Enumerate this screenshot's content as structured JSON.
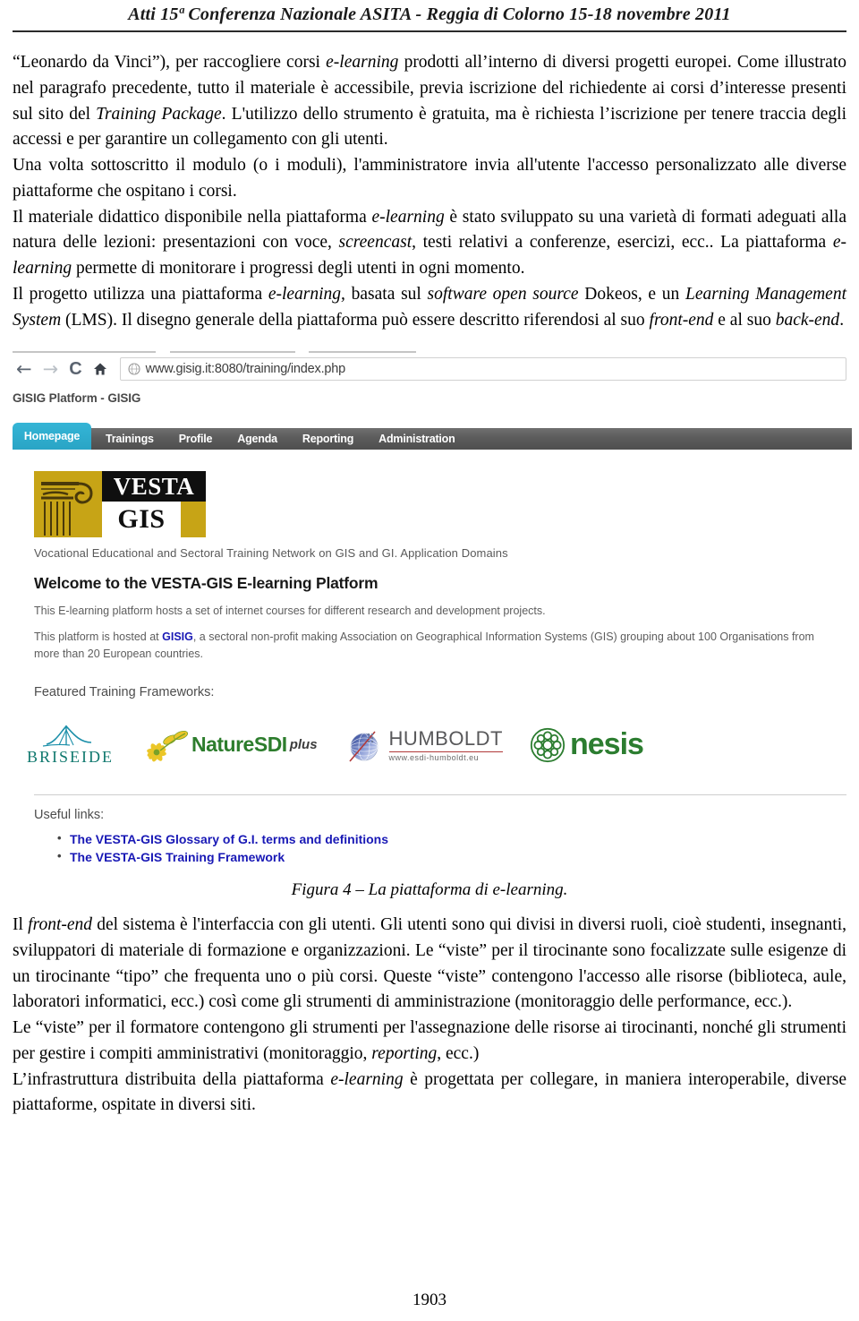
{
  "header": {
    "running_title": "Atti 15ª Conferenza Nazionale ASITA - Reggia di Colorno 15-18 novembre 2011"
  },
  "document": {
    "paragraphs": [
      {
        "id": "p1",
        "runs": [
          {
            "t": "“Leonardo da Vinci”), per raccogliere corsi ",
            "i": false
          },
          {
            "t": "e-learning",
            "i": true
          },
          {
            "t": " prodotti all’interno di diversi progetti europei. Come illustrato nel paragrafo precedente, tutto il materiale è accessibile, previa iscrizione del richiedente ai corsi d’interesse presenti sul sito del ",
            "i": false
          },
          {
            "t": "Training Package",
            "i": true
          },
          {
            "t": ". L'utilizzo dello strumento è gratuita, ma è richiesta l’iscrizione per tenere traccia degli accessi e per garantire un collegamento con gli utenti.",
            "i": false
          }
        ]
      },
      {
        "id": "p2",
        "runs": [
          {
            "t": "Una volta sottoscritto il modulo (o i moduli), l'amministratore invia all'utente l'accesso personalizzato alle diverse piattaforme che ospitano i corsi.",
            "i": false
          }
        ]
      },
      {
        "id": "p3",
        "runs": [
          {
            "t": "Il materiale didattico disponibile nella piattaforma ",
            "i": false
          },
          {
            "t": "e-learning",
            "i": true
          },
          {
            "t": " è stato sviluppato su una varietà di formati adeguati alla natura delle lezioni: presentazioni con voce, ",
            "i": false
          },
          {
            "t": "screencast",
            "i": true
          },
          {
            "t": ", testi relativi a conferenze, esercizi, ecc.. La piattaforma ",
            "i": false
          },
          {
            "t": "e-learning",
            "i": true
          },
          {
            "t": " permette di monitorare i progressi degli utenti in ogni momento.",
            "i": false
          }
        ]
      },
      {
        "id": "p4",
        "runs": [
          {
            "t": "Il progetto utilizza una piattaforma ",
            "i": false
          },
          {
            "t": "e-learning,",
            "i": true
          },
          {
            "t": " basata sul ",
            "i": false
          },
          {
            "t": "software   open source",
            "i": true
          },
          {
            "t": " Dokeos, e un ",
            "i": false
          },
          {
            "t": "Learning Management System",
            "i": true
          },
          {
            "t": " (LMS). Il disegno generale della piattaforma può essere descritto riferendosi al suo ",
            "i": false
          },
          {
            "t": "front-end",
            "i": true
          },
          {
            "t": " e al suo ",
            "i": false
          },
          {
            "t": "back-end",
            "i": true
          },
          {
            "t": ".",
            "i": false
          }
        ]
      }
    ],
    "caption": "Figura 4 – La piattaforma di e-learning.",
    "paragraphs_after": [
      {
        "id": "p5",
        "runs": [
          {
            "t": "Il ",
            "i": false
          },
          {
            "t": "front-end",
            "i": true
          },
          {
            "t": " del sistema è l'interfaccia con gli utenti. Gli utenti sono qui divisi in diversi ruoli, cioè studenti, insegnanti, sviluppatori di materiale di formazione e organizzazioni. Le “viste” per il tirocinante sono focalizzate sulle esigenze di un tirocinante “tipo” che frequenta uno o più corsi. Queste “viste” contengono l'accesso alle risorse (biblioteca, aule, laboratori informatici, ecc.) così come gli strumenti di amministrazione (monitoraggio delle performance, ecc.).",
            "i": false
          }
        ]
      },
      {
        "id": "p6",
        "runs": [
          {
            "t": "Le “viste” per il formatore contengono gli strumenti per l'assegnazione delle risorse ai tirocinanti, nonché gli strumenti per gestire i compiti amministrativi (monitoraggio, ",
            "i": false
          },
          {
            "t": "reporting",
            "i": true
          },
          {
            "t": ", ecc.)",
            "i": false
          }
        ]
      },
      {
        "id": "p7",
        "runs": [
          {
            "t": "L’infrastruttura distribuita della piattaforma ",
            "i": false
          },
          {
            "t": "e-learning",
            "i": true
          },
          {
            "t": " è progettata per collegare, in maniera interoperabile, diverse piattaforme, ospitate in diversi siti.",
            "i": false
          }
        ]
      }
    ],
    "page_number": "1903"
  },
  "screenshot": {
    "browser": {
      "back_icon": "back-arrow-icon",
      "forward_icon": "forward-arrow-icon",
      "reload_label": "C",
      "home_icon": "home-icon",
      "globe_icon": "globe-icon",
      "url": "www.gisig.it:8080/training/index.php",
      "page_title": "GISIG Platform - GISIG"
    },
    "nav": {
      "active_tab": "Homepage",
      "items": [
        "Trainings",
        "Profile",
        "Agenda",
        "Reporting",
        "Administration"
      ],
      "active_color": "#2ba3c4",
      "bar_color": "#5d5d5d"
    },
    "logo": {
      "vesta": "VESTA",
      "gis": "GIS",
      "gold": "#C6A318"
    },
    "tagline": "Vocational Educational and Sectoral Training Network on GIS and GI. Application Domains",
    "welcome_heading": "Welcome to the VESTA-GIS E-learning Platform",
    "intro_1": "This E-learning platform hosts a set of internet courses for different research and development projects.",
    "intro_2_before": "This platform is hosted at ",
    "intro_2_link": "GISIG",
    "intro_2_after": ", a sectoral non-profit making Association on Geographical Information Systems (GIS) grouping about 100 Organisations from more than 20 European countries.",
    "featured_heading": "Featured Training Frameworks:",
    "partners": [
      {
        "name": "BRISEIDE",
        "color": "#12786e"
      },
      {
        "name": "NatureSDI",
        "suffix": "plus",
        "color": "#2f7d2f"
      },
      {
        "name": "HUMBOLDT",
        "sub": "www.esdi-humboldt.eu",
        "color": "#59595b"
      },
      {
        "name": "nesis",
        "color": "#2e7d32"
      }
    ],
    "useful_links_heading": "Useful links:",
    "useful_links": [
      "The VESTA-GIS Glossary of G.I. terms and definitions",
      "The VESTA-GIS Training Framework"
    ]
  }
}
